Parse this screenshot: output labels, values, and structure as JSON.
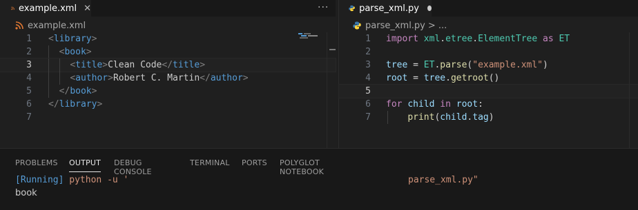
{
  "left_editor": {
    "tab": {
      "label": "example.xml",
      "close": "✕"
    },
    "more": "···",
    "breadcrumb": "example.xml",
    "lines": [
      {
        "n": "1",
        "tokens": [
          [
            "br",
            "<"
          ],
          [
            "tag",
            "library"
          ],
          [
            "br",
            ">"
          ]
        ]
      },
      {
        "n": "2",
        "tokens": [
          [
            "txt",
            "  "
          ],
          [
            "br",
            "<"
          ],
          [
            "tag",
            "book"
          ],
          [
            "br",
            ">"
          ]
        ]
      },
      {
        "n": "3",
        "tokens": [
          [
            "txt",
            "    "
          ],
          [
            "br",
            "<"
          ],
          [
            "tag",
            "title"
          ],
          [
            "br",
            ">"
          ],
          [
            "txt",
            "Clean Code"
          ],
          [
            "br",
            "</"
          ],
          [
            "tag",
            "title"
          ],
          [
            "br",
            ">"
          ]
        ]
      },
      {
        "n": "4",
        "tokens": [
          [
            "txt",
            "    "
          ],
          [
            "br",
            "<"
          ],
          [
            "tag",
            "author"
          ],
          [
            "br",
            ">"
          ],
          [
            "txt",
            "Robert C. Martin"
          ],
          [
            "br",
            "</"
          ],
          [
            "tag",
            "author"
          ],
          [
            "br",
            ">"
          ]
        ]
      },
      {
        "n": "5",
        "tokens": [
          [
            "txt",
            "  "
          ],
          [
            "br",
            "</"
          ],
          [
            "tag",
            "book"
          ],
          [
            "br",
            ">"
          ]
        ]
      },
      {
        "n": "6",
        "tokens": [
          [
            "br",
            "</"
          ],
          [
            "tag",
            "library"
          ],
          [
            "br",
            ">"
          ]
        ]
      },
      {
        "n": "7",
        "tokens": []
      }
    ]
  },
  "right_editor": {
    "tab": {
      "label": "parse_xml.py"
    },
    "breadcrumb": "parse_xml.py",
    "breadcrumb_tail": "> ...",
    "lines": [
      {
        "n": "1",
        "tokens": [
          [
            "kw",
            "import"
          ],
          [
            "op",
            " "
          ],
          [
            "mod",
            "xml"
          ],
          [
            "op",
            "."
          ],
          [
            "mod",
            "etree"
          ],
          [
            "op",
            "."
          ],
          [
            "mod",
            "ElementTree"
          ],
          [
            "op",
            " "
          ],
          [
            "kw",
            "as"
          ],
          [
            "op",
            " "
          ],
          [
            "mod",
            "ET"
          ]
        ]
      },
      {
        "n": "2",
        "tokens": []
      },
      {
        "n": "3",
        "tokens": [
          [
            "var",
            "tree"
          ],
          [
            "op",
            " = "
          ],
          [
            "mod",
            "ET"
          ],
          [
            "op",
            "."
          ],
          [
            "fn",
            "parse"
          ],
          [
            "op",
            "("
          ],
          [
            "str",
            "\"example.xml\""
          ],
          [
            "op",
            ")"
          ]
        ]
      },
      {
        "n": "4",
        "tokens": [
          [
            "var",
            "root"
          ],
          [
            "op",
            " = "
          ],
          [
            "var",
            "tree"
          ],
          [
            "op",
            "."
          ],
          [
            "fn",
            "getroot"
          ],
          [
            "op",
            "()"
          ]
        ]
      },
      {
        "n": "5",
        "tokens": []
      },
      {
        "n": "6",
        "tokens": [
          [
            "kw",
            "for"
          ],
          [
            "op",
            " "
          ],
          [
            "var",
            "child"
          ],
          [
            "op",
            " "
          ],
          [
            "kw",
            "in"
          ],
          [
            "op",
            " "
          ],
          [
            "var",
            "root"
          ],
          [
            "op",
            ":"
          ]
        ]
      },
      {
        "n": "7",
        "tokens": [
          [
            "op",
            "    "
          ],
          [
            "fn",
            "print"
          ],
          [
            "op",
            "("
          ],
          [
            "var",
            "child"
          ],
          [
            "op",
            "."
          ],
          [
            "var",
            "tag"
          ],
          [
            "op",
            ")"
          ]
        ]
      }
    ]
  },
  "panel": {
    "tabs": [
      "PROBLEMS",
      "OUTPUT",
      "DEBUG CONSOLE",
      "TERMINAL",
      "PORTS",
      "POLYGLOT NOTEBOOK"
    ],
    "active_tab": "OUTPUT",
    "output": {
      "running": "[Running]",
      "command": " python -u '",
      "file": "parse_xml.py\"",
      "result": "book"
    }
  },
  "colors": {
    "accent_xml": "#e37933",
    "python_blue": "#3c78aa",
    "python_yellow": "#ffd43b"
  }
}
